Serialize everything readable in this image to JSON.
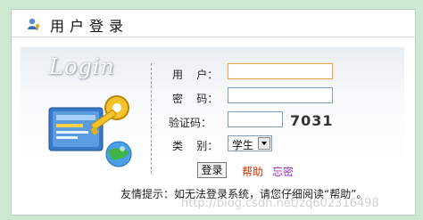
{
  "header": {
    "title": "用户登录",
    "icon": "user-key-icon"
  },
  "panel": {
    "logo_text": "Login"
  },
  "form": {
    "username": {
      "label": "用    户：",
      "value": ""
    },
    "password": {
      "label": "密    码：",
      "value": ""
    },
    "captcha": {
      "label": "验证码：",
      "value": "",
      "code": "7031"
    },
    "category": {
      "label": "类    别：",
      "selected": "学生"
    },
    "login_button": "登录",
    "help_link": "帮助",
    "forgot_link": "忘密"
  },
  "hint": "友情提示：如无法登录系统，请您仔细阅读“帮助”。",
  "watermark": "http://blog.csdn.net/zq602316498",
  "colors": {
    "background": "#cde8d2",
    "link_help": "#cc3300",
    "link_forgot": "#9933cc",
    "focus_border": "#e3a84b"
  }
}
